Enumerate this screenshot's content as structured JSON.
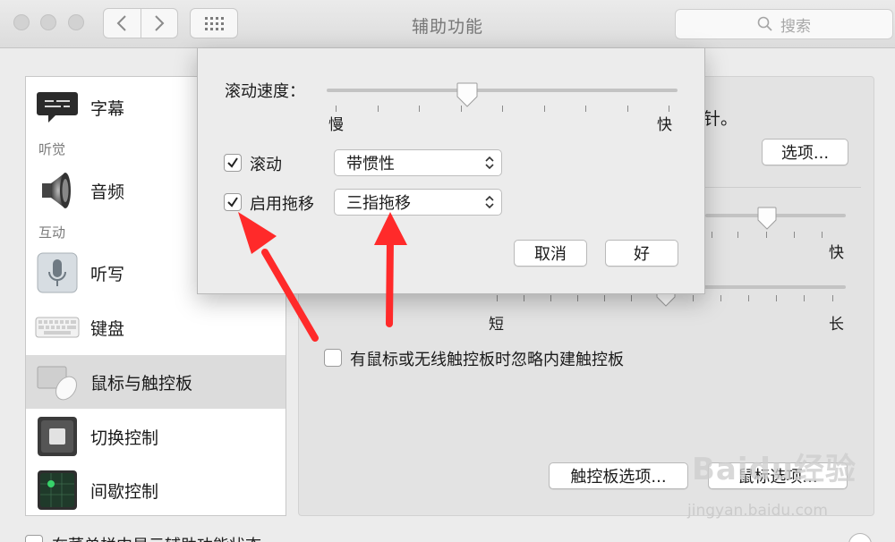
{
  "window": {
    "title": "辅助功能",
    "search_placeholder": "搜索"
  },
  "sidebar": {
    "items": [
      {
        "label": "字幕",
        "icon": "captions-icon"
      },
      {
        "label": "音频",
        "icon": "speaker-icon"
      },
      {
        "label": "听写",
        "icon": "microphone-icon"
      },
      {
        "label": "键盘",
        "icon": "keyboard-icon"
      },
      {
        "label": "鼠标与触控板",
        "icon": "mouse-trackpad-icon",
        "selected": true
      },
      {
        "label": "切换控制",
        "icon": "switch-control-icon"
      },
      {
        "label": "间歇控制",
        "icon": "dwell-control-icon"
      }
    ],
    "sections": {
      "hearing": "听觉",
      "interaction": "互动"
    }
  },
  "content": {
    "partial_text": "针。",
    "options_button": "选项...",
    "slider1_right_label": "快",
    "slider2_left_label": "短",
    "slider2_right_label": "长",
    "ignore_builtin_trackpad": {
      "label": "有鼠标或无线触控板时忽略内建触控板",
      "checked": false
    },
    "trackpad_options_button": "触控板选项...",
    "mouse_options_button": "鼠标选项..."
  },
  "sheet": {
    "scroll_speed_label": "滚动速度：",
    "scroll_speed_min": "慢",
    "scroll_speed_max": "快",
    "scroll_speed_value": 0.4,
    "scrolling": {
      "label": "滚动",
      "checked": true,
      "value": "带惯性"
    },
    "dragging": {
      "label": "启用拖移",
      "checked": true,
      "value": "三指拖移"
    },
    "cancel_button": "取消",
    "ok_button": "好"
  },
  "annotations": {
    "arrow_color": "#ff2a2a"
  },
  "watermark": {
    "logo": "Baidu经验",
    "url": "jingyan.baidu.com"
  },
  "bottom_partial": "在菜单栏中显示辅助功能状态"
}
